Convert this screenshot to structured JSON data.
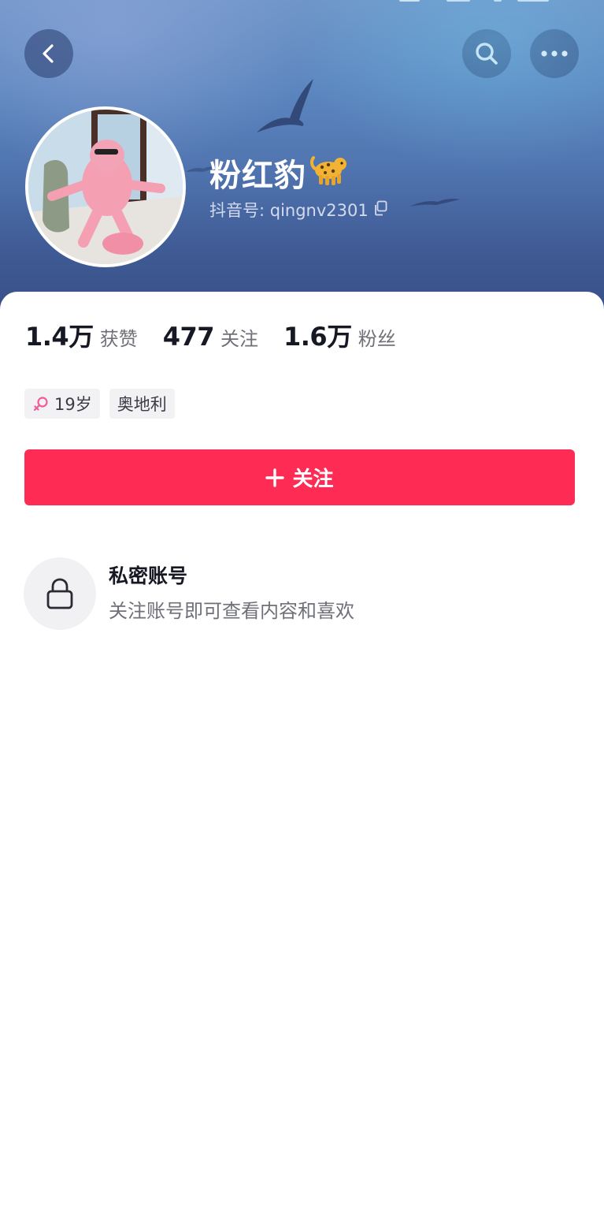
{
  "header": {
    "icons": {
      "back": "chevron-left-icon",
      "search": "search-icon",
      "more": "more-dots-icon"
    }
  },
  "profile": {
    "name": "粉红豹",
    "name_emoji": "🐆",
    "id_label": "抖音号: qingnv2301",
    "copy_icon": "copy-icon"
  },
  "stats": [
    {
      "value": "1.4万",
      "label": "获赞"
    },
    {
      "value": "477",
      "label": "关注"
    },
    {
      "value": "1.6万",
      "label": "粉丝"
    }
  ],
  "tags": {
    "age": "19岁",
    "gender_icon": "female-icon",
    "location": "奥地利"
  },
  "follow_button": {
    "label": "关注",
    "icon": "plus-icon"
  },
  "private_account": {
    "title": "私密账号",
    "subtitle": "关注账号即可查看内容和喜欢",
    "icon": "lock-icon"
  },
  "colors": {
    "accent": "#fe2c55",
    "text_primary": "#161823",
    "text_secondary": "#6f7078",
    "header_top": "#6f95c8",
    "header_bottom": "#38508a"
  }
}
